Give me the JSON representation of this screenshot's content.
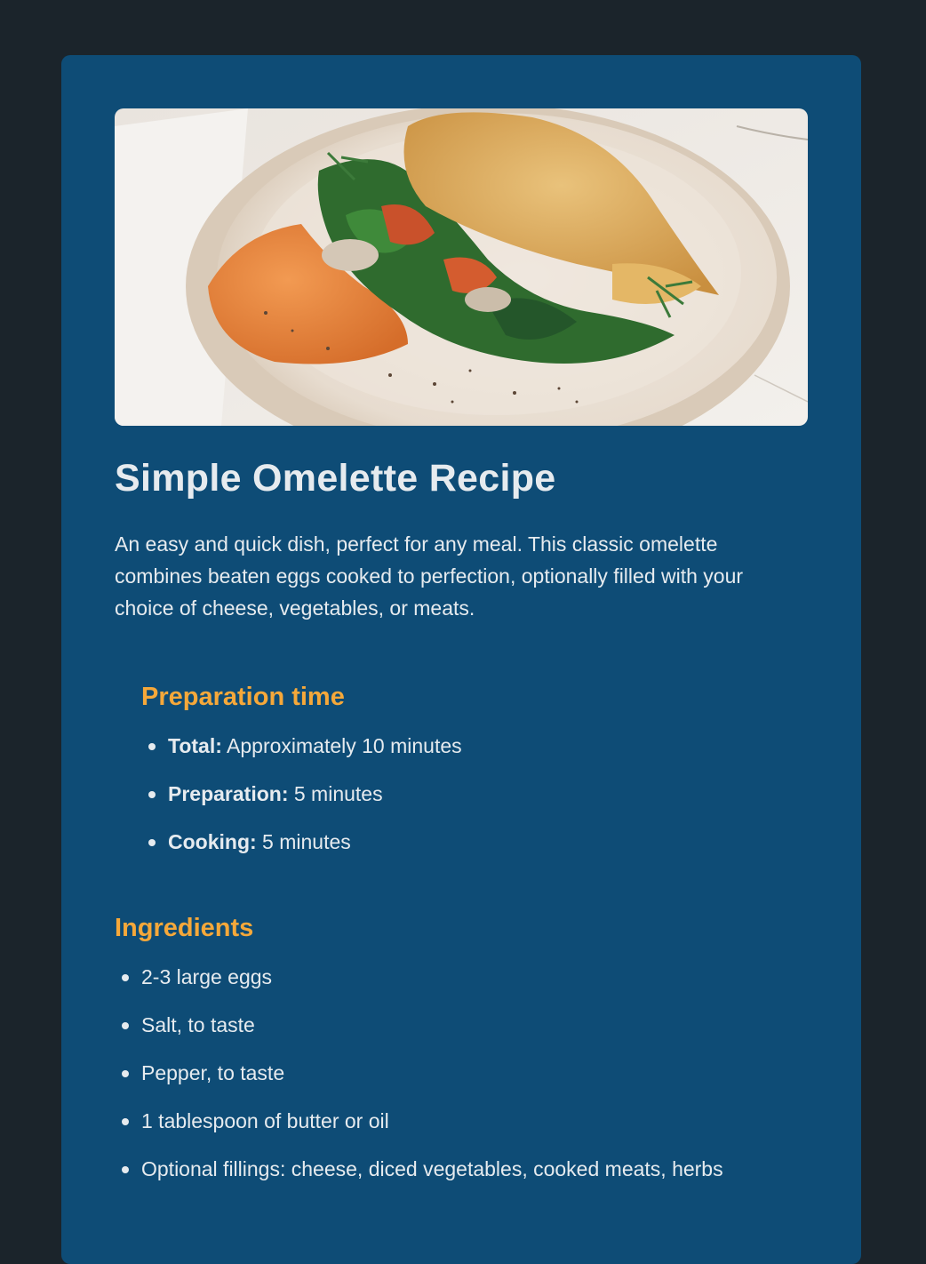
{
  "recipe": {
    "image_alt": "Omelette folded over spinach, tomato and mushrooms with orange spread on a cream plate",
    "title": "Simple Omelette Recipe",
    "description": "An easy and quick dish, perfect for any meal. This classic omelette combines beaten eggs cooked to perfection, optionally filled with your choice of cheese, vegetables, or meats."
  },
  "preparation": {
    "heading": "Preparation time",
    "items": [
      {
        "label": "Total:",
        "value": " Approximately 10 minutes"
      },
      {
        "label": "Preparation:",
        "value": " 5 minutes"
      },
      {
        "label": "Cooking:",
        "value": " 5 minutes"
      }
    ]
  },
  "ingredients": {
    "heading": "Ingredients",
    "items": [
      "2-3 large eggs",
      "Salt, to taste",
      "Pepper, to taste",
      "1 tablespoon of butter or oil",
      "Optional fillings: cheese, diced vegetables, cooked meats, herbs"
    ]
  },
  "colors": {
    "page_background": "#1b242b",
    "card_background": "#0e4c76",
    "heading_accent": "#f5a83a",
    "text": "#e6ebef"
  }
}
